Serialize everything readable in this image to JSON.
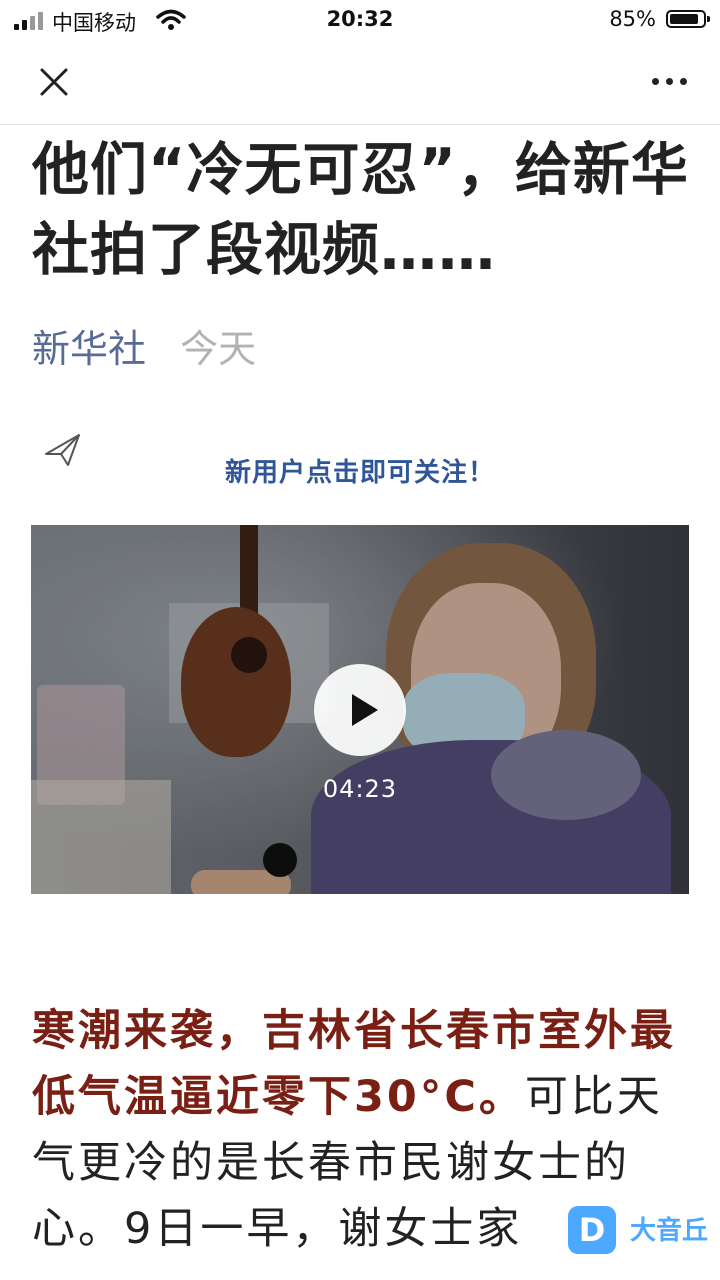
{
  "status_bar": {
    "carrier": "中国移动",
    "time": "20:32",
    "battery": "85%"
  },
  "nav": {
    "close_icon": "close-icon",
    "more_icon": "more-icon"
  },
  "article": {
    "title": "他们“冷无可忍”，给新华社拍了段视频……",
    "source": "新华社",
    "date": "今天",
    "follow_banner": "新用户点击即可关注！",
    "video": {
      "duration": "04:23"
    },
    "body_highlight": "寒潮来袭，吉林省长春市室外最低气温逼近零下30°C。",
    "body_rest": "可比天气更冷的是长春市民谢女士的心。9日一早，谢女士家"
  },
  "watermark": {
    "logo": "D",
    "text": "大音丘"
  }
}
